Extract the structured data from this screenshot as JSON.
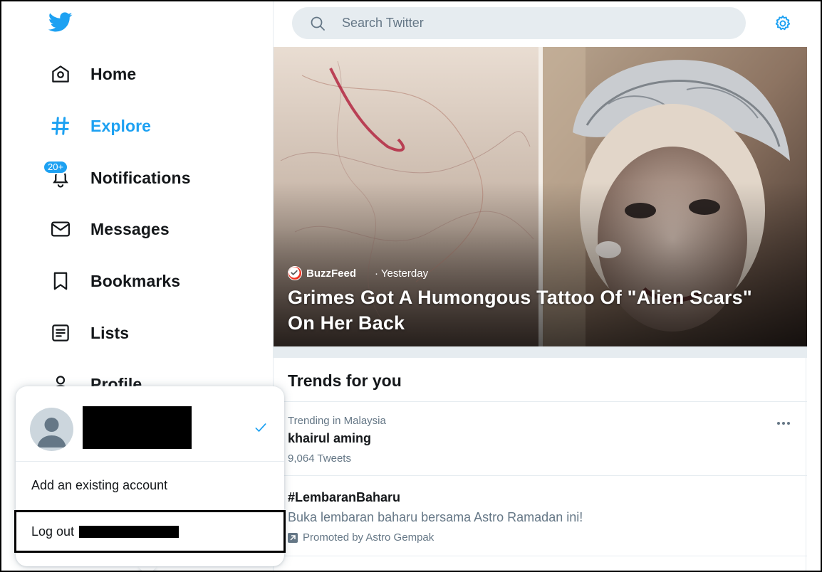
{
  "app": {
    "brand_color": "#1da1f2",
    "text_color": "#14171a",
    "muted_color": "#657786"
  },
  "nav": {
    "items": [
      {
        "label": "Home",
        "icon": "home-icon"
      },
      {
        "label": "Explore",
        "icon": "hashtag-icon",
        "active": true
      },
      {
        "label": "Notifications",
        "icon": "bell-icon",
        "badge": "20+"
      },
      {
        "label": "Messages",
        "icon": "envelope-icon"
      },
      {
        "label": "Bookmarks",
        "icon": "bookmark-icon"
      },
      {
        "label": "Lists",
        "icon": "list-icon"
      },
      {
        "label": "Profile",
        "icon": "person-icon"
      }
    ]
  },
  "account_menu": {
    "add_account": "Add an existing account",
    "logout_prefix": "Log out"
  },
  "search": {
    "placeholder": "Search Twitter"
  },
  "hero": {
    "source": "BuzzFeed",
    "time": "· Yesterday",
    "title": "Grimes Got A Humongous Tattoo Of \"Alien Scars\" On Her Back"
  },
  "trends": {
    "heading": "Trends for you",
    "items": [
      {
        "context": "Trending in Malaysia",
        "name": "khairul aming",
        "count": "9,064 Tweets"
      },
      {
        "name": "#LembaranBaharu",
        "description": "Buka lembaran baharu bersama Astro Ramadan ini!",
        "promoted": "Promoted by Astro Gempak"
      }
    ]
  }
}
